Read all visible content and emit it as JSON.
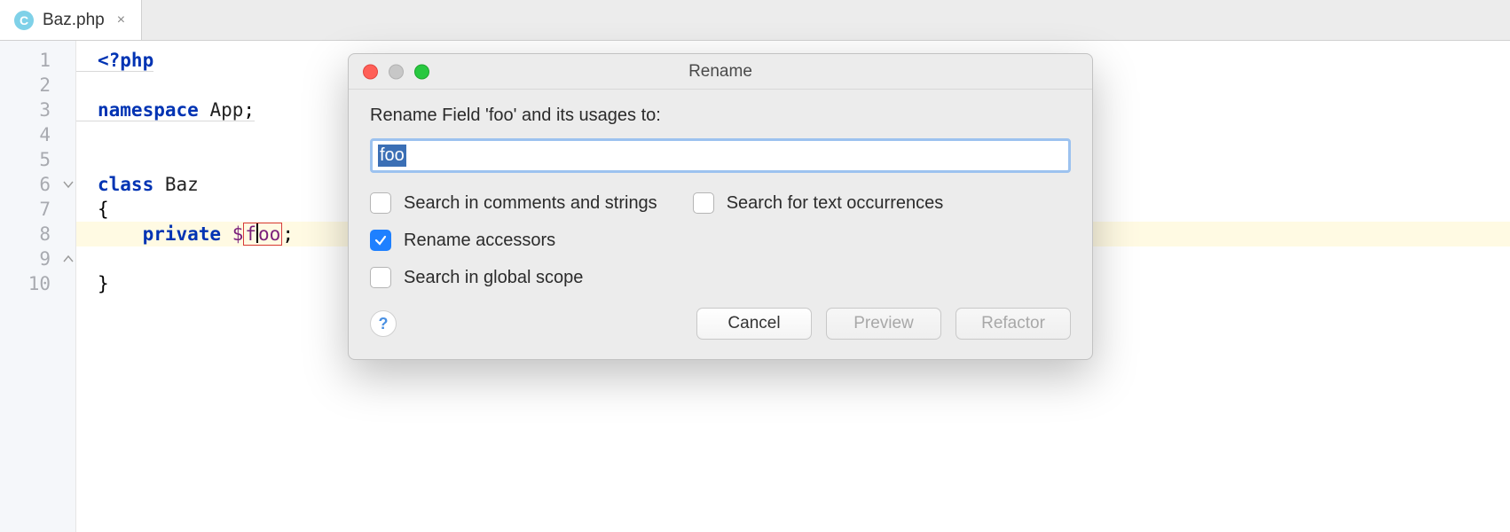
{
  "tab": {
    "icon_letter": "C",
    "filename": "Baz.php"
  },
  "editor": {
    "lines": {
      "l1": "<?php",
      "l3a": "namespace ",
      "l3b": "App",
      "l3c": ";",
      "l6a": "class ",
      "l6b": "Baz",
      "l7": "{",
      "l8a": "    private ",
      "l8b": "$",
      "l8c": "foo",
      "l8d": ";",
      "l9": "}"
    },
    "line_numbers": [
      "1",
      "2",
      "3",
      "4",
      "5",
      "6",
      "7",
      "8",
      "9",
      "10"
    ]
  },
  "dialog": {
    "title": "Rename",
    "label": "Rename Field 'foo' and its usages to:",
    "input_value": "foo",
    "checks": {
      "comments": "Search in comments and strings",
      "textocc": "Search for text occurrences",
      "accessors": "Rename accessors",
      "global": "Search in global scope"
    },
    "buttons": {
      "help": "?",
      "cancel": "Cancel",
      "preview": "Preview",
      "refactor": "Refactor"
    }
  }
}
